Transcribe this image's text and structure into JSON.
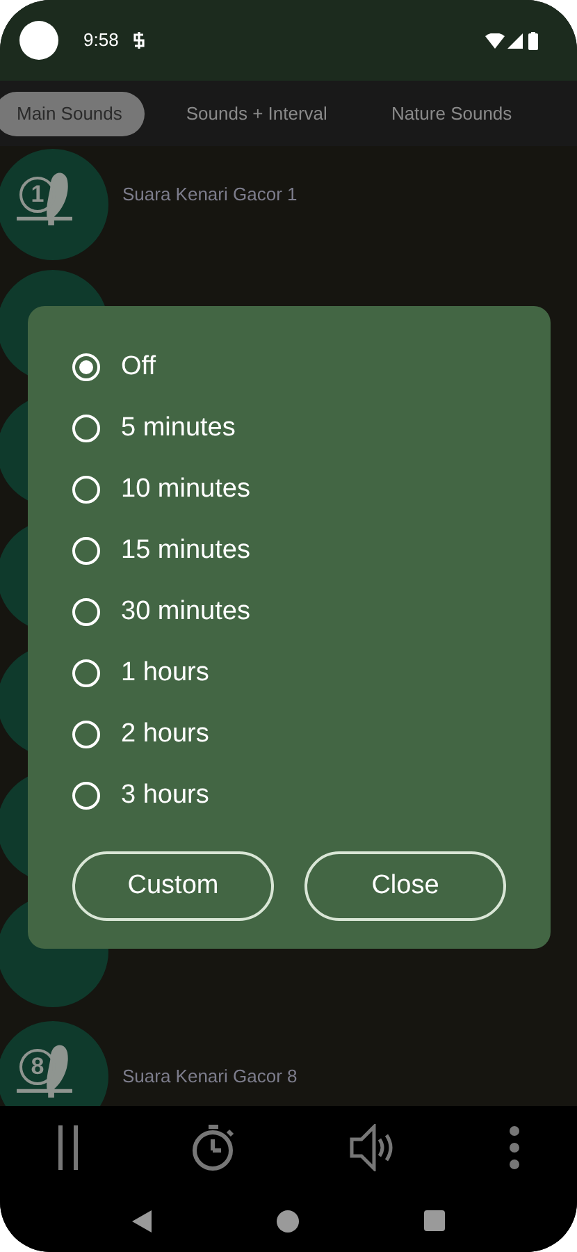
{
  "status_bar": {
    "time": "9:58"
  },
  "tabs": [
    {
      "label": "Main Sounds",
      "selected": true
    },
    {
      "label": "Sounds + Interval",
      "selected": false
    },
    {
      "label": "Nature Sounds",
      "selected": false
    }
  ],
  "sounds": [
    {
      "kind": "track",
      "number": "1",
      "title": "Suara Kenari Gacor 1"
    },
    {
      "kind": "covered"
    },
    {
      "kind": "covered"
    },
    {
      "kind": "covered"
    },
    {
      "kind": "covered"
    },
    {
      "kind": "covered"
    },
    {
      "kind": "covered"
    },
    {
      "kind": "track",
      "number": "8",
      "title": "Suara Kenari Gacor  8"
    }
  ],
  "timer_dialog": {
    "options": [
      {
        "label": "Off",
        "selected": true
      },
      {
        "label": "5 minutes",
        "selected": false
      },
      {
        "label": "10 minutes",
        "selected": false
      },
      {
        "label": "15 minutes",
        "selected": false
      },
      {
        "label": "30 minutes",
        "selected": false
      },
      {
        "label": "1 hours",
        "selected": false
      },
      {
        "label": "2 hours",
        "selected": false
      },
      {
        "label": "3 hours",
        "selected": false
      }
    ],
    "buttons": [
      "Custom",
      "Close"
    ]
  }
}
